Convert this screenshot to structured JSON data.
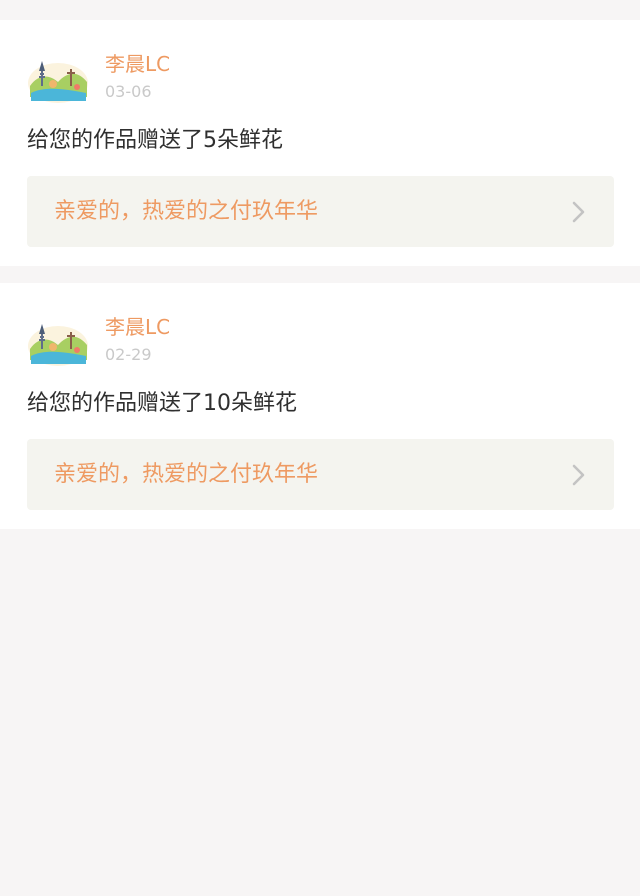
{
  "notifications": [
    {
      "avatar_icon": "landscape-avatar-icon",
      "user_name": "李晨LC",
      "date": "03-06",
      "message": "给您的作品赠送了5朵鲜花",
      "work_title": "亲爱的，热爱的之付玖年华",
      "chevron_icon": "chevron-right-icon"
    },
    {
      "avatar_icon": "landscape-avatar-icon",
      "user_name": "李晨LC",
      "date": "02-29",
      "message": "给您的作品赠送了10朵鲜花",
      "work_title": "亲爱的，热爱的之付玖年华",
      "chevron_icon": "chevron-right-icon"
    }
  ],
  "colors": {
    "page_background": "#f7f5f5",
    "card_background": "#ffffff",
    "accent": "#ee9a62",
    "date_text": "#c9c9c9",
    "message_text": "#2f2f2f",
    "link_background": "#f4f4ef",
    "chevron": "#c3c3c3"
  }
}
